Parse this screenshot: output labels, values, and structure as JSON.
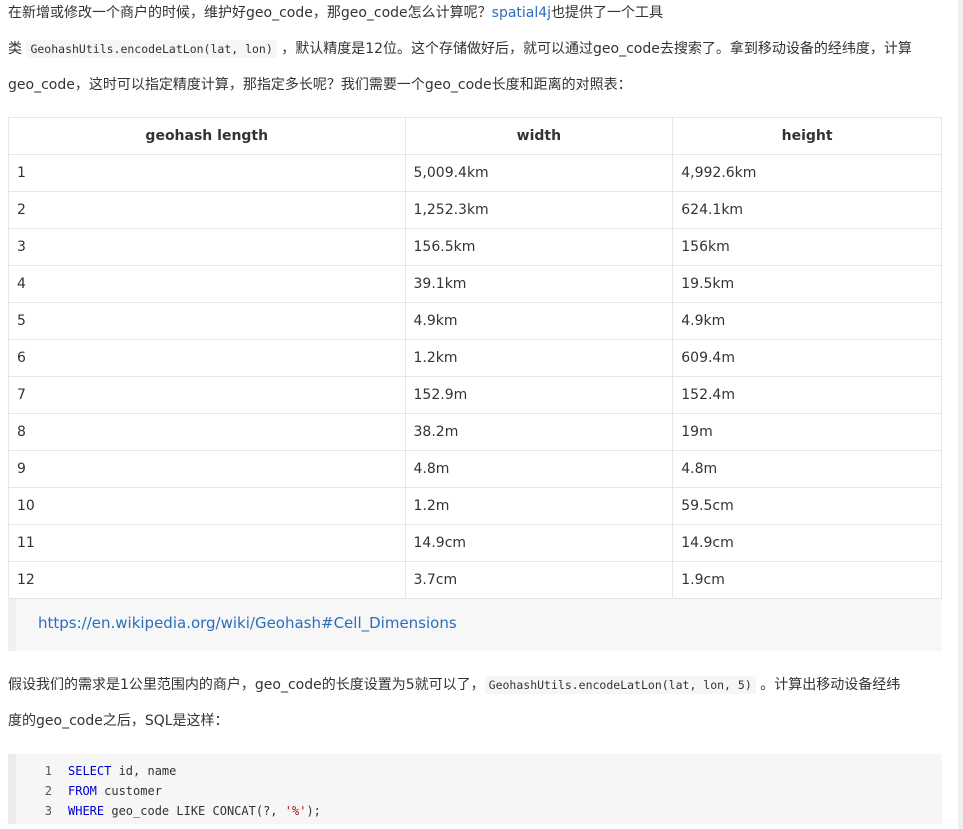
{
  "intro": {
    "line1_prefix": "在新增或修改一个商户的时候，维护好geo_code，那geo_code怎么计算呢？",
    "line1_link": "spatial4j",
    "line1_suffix": "也提供了一个工具",
    "line2_prefix": "类 ",
    "line2_code": "GeohashUtils.encodeLatLon(lat, lon)",
    "line2_suffix": " ，默认精度是12位。这个存储做好后，就可以通过geo_code去搜索了。拿到移动设备的经纬度，计算",
    "line3": "geo_code，这时可以指定精度计算，那指定多长呢？我们需要一个geo_code长度和距离的对照表："
  },
  "table": {
    "headers": [
      "geohash length",
      "width",
      "height"
    ],
    "rows": [
      [
        "1",
        "5,009.4km",
        "4,992.6km"
      ],
      [
        "2",
        "1,252.3km",
        "624.1km"
      ],
      [
        "3",
        "156.5km",
        "156km"
      ],
      [
        "4",
        "39.1km",
        "19.5km"
      ],
      [
        "5",
        "4.9km",
        "4.9km"
      ],
      [
        "6",
        "1.2km",
        "609.4m"
      ],
      [
        "7",
        "152.9m",
        "152.4m"
      ],
      [
        "8",
        "38.2m",
        "19m"
      ],
      [
        "9",
        "4.8m",
        "4.8m"
      ],
      [
        "10",
        "1.2m",
        "59.5cm"
      ],
      [
        "11",
        "14.9cm",
        "14.9cm"
      ],
      [
        "12",
        "3.7cm",
        "1.9cm"
      ]
    ]
  },
  "quote": {
    "link": "https://en.wikipedia.org/wiki/Geohash#Cell_Dimensions"
  },
  "para2": {
    "prefix": "假设我们的需求是1公里范围内的商户，geo_code的长度设置为5就可以了，",
    "code": "GeohashUtils.encodeLatLon(lat, lon, 5)",
    "suffix": " 。计算出移动设备经纬",
    "line2": "度的geo_code之后，SQL是这样："
  },
  "code": {
    "lines": [
      {
        "num": "1",
        "kw": "SELECT",
        "rest": " id, name",
        "str": "",
        "tail": ""
      },
      {
        "num": "2",
        "kw": "FROM",
        "rest": " customer",
        "str": "",
        "tail": ""
      },
      {
        "num": "3",
        "kw": "WHERE",
        "rest": " geo_code LIKE CONCAT(?, ",
        "str": "'%'",
        "tail": ");"
      }
    ]
  },
  "colors": {
    "link": "#2a6ebb",
    "keyword": "#0000cc",
    "string": "#a31515"
  }
}
